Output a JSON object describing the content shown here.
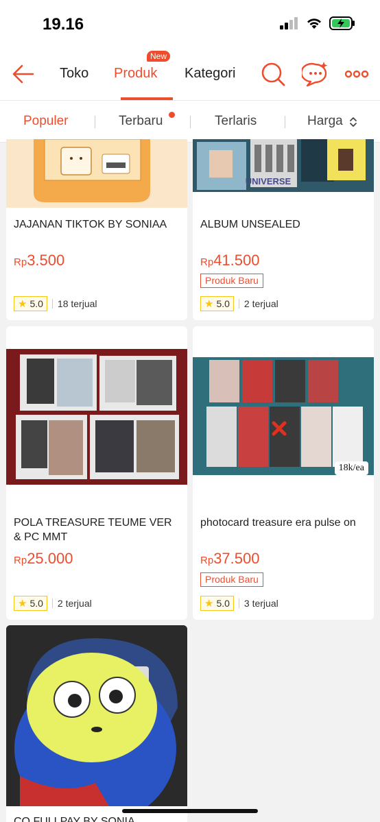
{
  "status_bar": {
    "time": "19.16"
  },
  "header": {
    "tabs": [
      {
        "label": "Toko"
      },
      {
        "label": "Produk",
        "active": true,
        "badge": "New"
      },
      {
        "label": "Kategori"
      }
    ]
  },
  "sort_bar": {
    "items": [
      {
        "label": "Populer",
        "active": true
      },
      {
        "label": "Terbaru",
        "dot": true
      },
      {
        "label": "Terlaris"
      },
      {
        "label": "Harga"
      }
    ]
  },
  "products": [
    {
      "name": "JAJANAN TIKTOK BY SONIAA",
      "currency": "Rp",
      "price": "3.500",
      "rating": "5.0",
      "sold": "18 terjual",
      "image": "muffin-corner-bread-pouch"
    },
    {
      "name": "ALBUM UNSEALED",
      "currency": "Rp",
      "price": "41.500",
      "tag": "Produk Baru",
      "rating": "5.0",
      "sold": "2 terjual",
      "image": "album-photocards",
      "image_text": "UNIVERSE"
    },
    {
      "name": "POLA TREASURE TEUME VER & PC MMT",
      "currency": "Rp",
      "price": "25.000",
      "rating": "5.0",
      "sold": "2 terjual",
      "image": "treasure-polaroids"
    },
    {
      "name": "photocard treasure era pulse on",
      "currency": "Rp",
      "price": "37.500",
      "tag": "Produk Baru",
      "rating": "5.0",
      "sold": "3 terjual",
      "image": "pulse-photocards",
      "watermark": "18k/ea"
    },
    {
      "name": "CO FULLPAY BY SONIA",
      "image": "blue-plush-keychain"
    }
  ],
  "colors": {
    "accent": "#ee4d2d",
    "star": "#f5c518"
  }
}
